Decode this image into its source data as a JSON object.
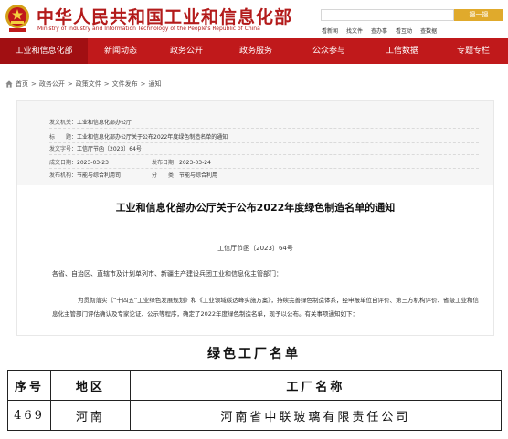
{
  "header": {
    "site_title": "中华人民共和国工业和信息化部",
    "site_subtitle": "Ministry of Industry and Information Technology of the People's Republic of China",
    "search": {
      "placeholder": "",
      "button_label": "搜一搜"
    },
    "quick_links": [
      "看新闻",
      "找文件",
      "查办事",
      "看互动",
      "查数据"
    ]
  },
  "nav": {
    "items": [
      {
        "label": "工业和信息化部",
        "active": true
      },
      {
        "label": "新闻动态"
      },
      {
        "label": "政务公开"
      },
      {
        "label": "政务服务"
      },
      {
        "label": "公众参与"
      },
      {
        "label": "工信数据"
      },
      {
        "label": "专题专栏"
      }
    ]
  },
  "breadcrumb": {
    "items": [
      "首页",
      "政务公开",
      "政策文件",
      "文件发布",
      "通知"
    ],
    "separator": ">"
  },
  "meta": {
    "issuer_label": "发文机关：",
    "issuer": "工业和信息化部办公厅",
    "title_label": "标　　题：",
    "title": "工业和信息化部办公厅关于公布2022年度绿色制造名单的通知",
    "doc_no_label": "发文字号：",
    "doc_no": "工信厅节函〔2023〕64号",
    "created_label": "成文日期：",
    "created": "2023-03-23",
    "published_label": "发布日期：",
    "published": "2023-03-24",
    "dept_label": "发布机构：",
    "dept": "节能与综合利用司",
    "category_label": "分　　类：",
    "category": "节能与综合利用"
  },
  "article": {
    "title": "工业和信息化部办公厅关于公布2022年度绿色制造名单的通知",
    "doc_number": "工信厅节函〔2023〕64号",
    "salutation": "各省、自治区、直辖市及计划单列市、新疆生产建设兵团工业和信息化主管部门：",
    "body": "为贯彻落实《“十四五”工业绿色发展规划》和《工业领域碳达峰实施方案》，持续完善绿色制造体系，经申报单位自评价、第三方机构评价、省级工业和信息化主管部门评估确认及专家论证、公示等程序，确定了2022年度绿色制造名单，现予以公布。有关事项通知如下："
  },
  "factory_list": {
    "title": "绿色工厂名单",
    "headers": [
      "序号",
      "地区",
      "工厂名称"
    ],
    "rows": [
      [
        "469",
        "河南",
        "河南省中联玻璃有限责任公司"
      ]
    ]
  },
  "colors": {
    "brand_red": "#c0191b",
    "nav_active": "#a10f12",
    "search_button": "#e0aa2c",
    "meta_background": "#f6f6f6"
  },
  "icons": [
    "national-emblem-icon",
    "home-icon"
  ]
}
